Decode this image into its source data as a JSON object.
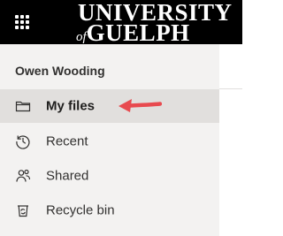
{
  "header": {
    "waffle_icon": "app-launcher-icon",
    "logo": {
      "line1": "UNIVERSITY",
      "line2_prefix": "of",
      "line2_main": "GUELPH"
    },
    "background_color": "#000000"
  },
  "sidebar": {
    "user_name": "Owen Wooding",
    "items": [
      {
        "label": "My files",
        "icon": "folder-icon",
        "selected": true
      },
      {
        "label": "Recent",
        "icon": "history-icon",
        "selected": false
      },
      {
        "label": "Shared",
        "icon": "people-icon",
        "selected": false
      },
      {
        "label": "Recycle bin",
        "icon": "recycle-bin-icon",
        "selected": false
      }
    ],
    "background_color": "#f3f2f1",
    "selected_color": "#e1dfdd"
  },
  "annotation": {
    "arrow_color": "#e84a4f",
    "points_to": "My files"
  }
}
